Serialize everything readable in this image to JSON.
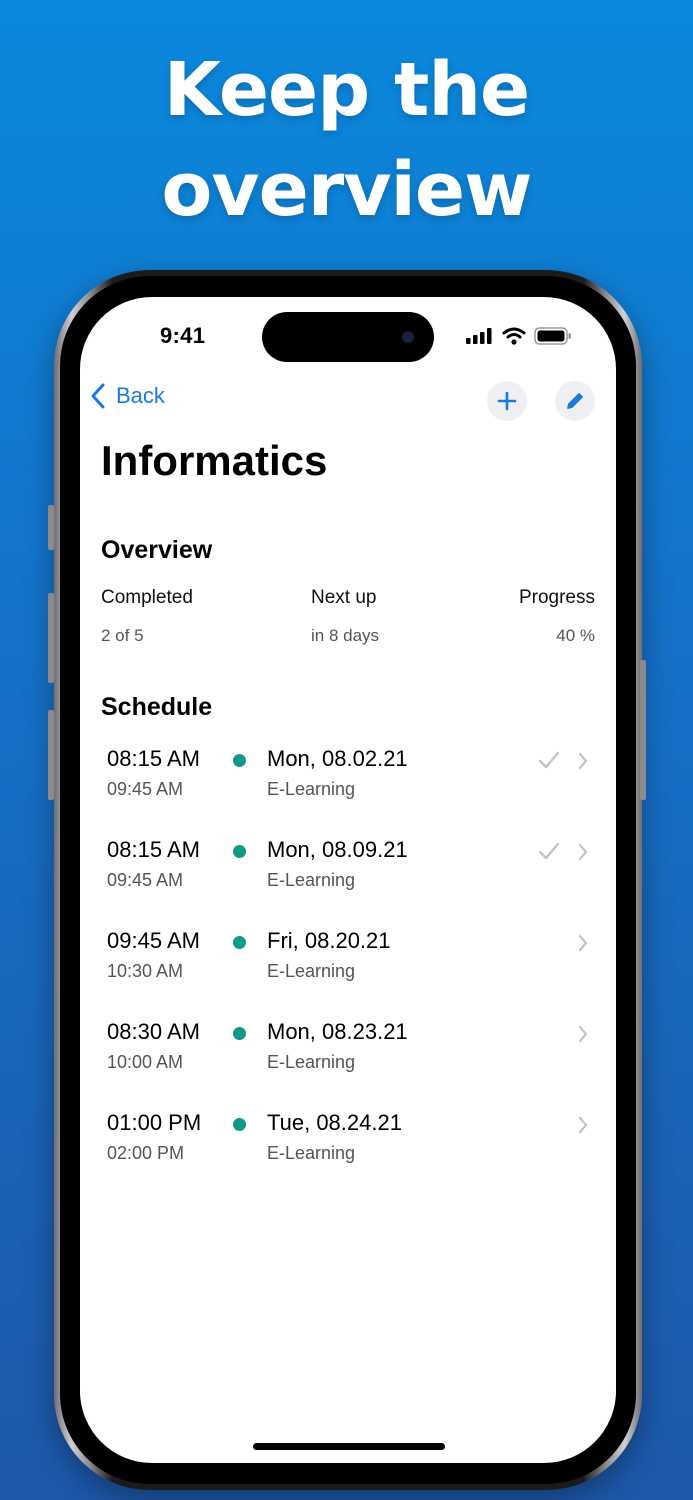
{
  "headline": {
    "line1": "Keep the",
    "line2": "overview"
  },
  "status_bar": {
    "time": "9:41",
    "icons": [
      "cellular-signal-icon",
      "wifi-icon",
      "battery-icon"
    ]
  },
  "nav": {
    "back_label": "Back",
    "add_icon": "plus-icon",
    "edit_icon": "pencil-icon",
    "accent_color": "#1a7ae0"
  },
  "page_title": "Informatics",
  "overview": {
    "title": "Overview",
    "completed_label": "Completed",
    "completed_value": "2 of 5",
    "next_label": "Next up",
    "next_value": "in 8 days",
    "progress_label": "Progress",
    "progress_value": "40 %"
  },
  "schedule": {
    "title": "Schedule",
    "dot_color": "#0e9a85",
    "items": [
      {
        "start": "08:15 AM",
        "end": "09:45 AM",
        "date": "Mon, 08.02.21",
        "type": "E-Learning",
        "completed": true
      },
      {
        "start": "08:15 AM",
        "end": "09:45 AM",
        "date": "Mon, 08.09.21",
        "type": "E-Learning",
        "completed": true
      },
      {
        "start": "09:45 AM",
        "end": "10:30 AM",
        "date": "Fri, 08.20.21",
        "type": "E-Learning",
        "completed": false
      },
      {
        "start": "08:30 AM",
        "end": "10:00 AM",
        "date": "Mon, 08.23.21",
        "type": "E-Learning",
        "completed": false
      },
      {
        "start": "01:00 PM",
        "end": "02:00 PM",
        "date": "Tue, 08.24.21",
        "type": "E-Learning",
        "completed": false
      }
    ]
  }
}
